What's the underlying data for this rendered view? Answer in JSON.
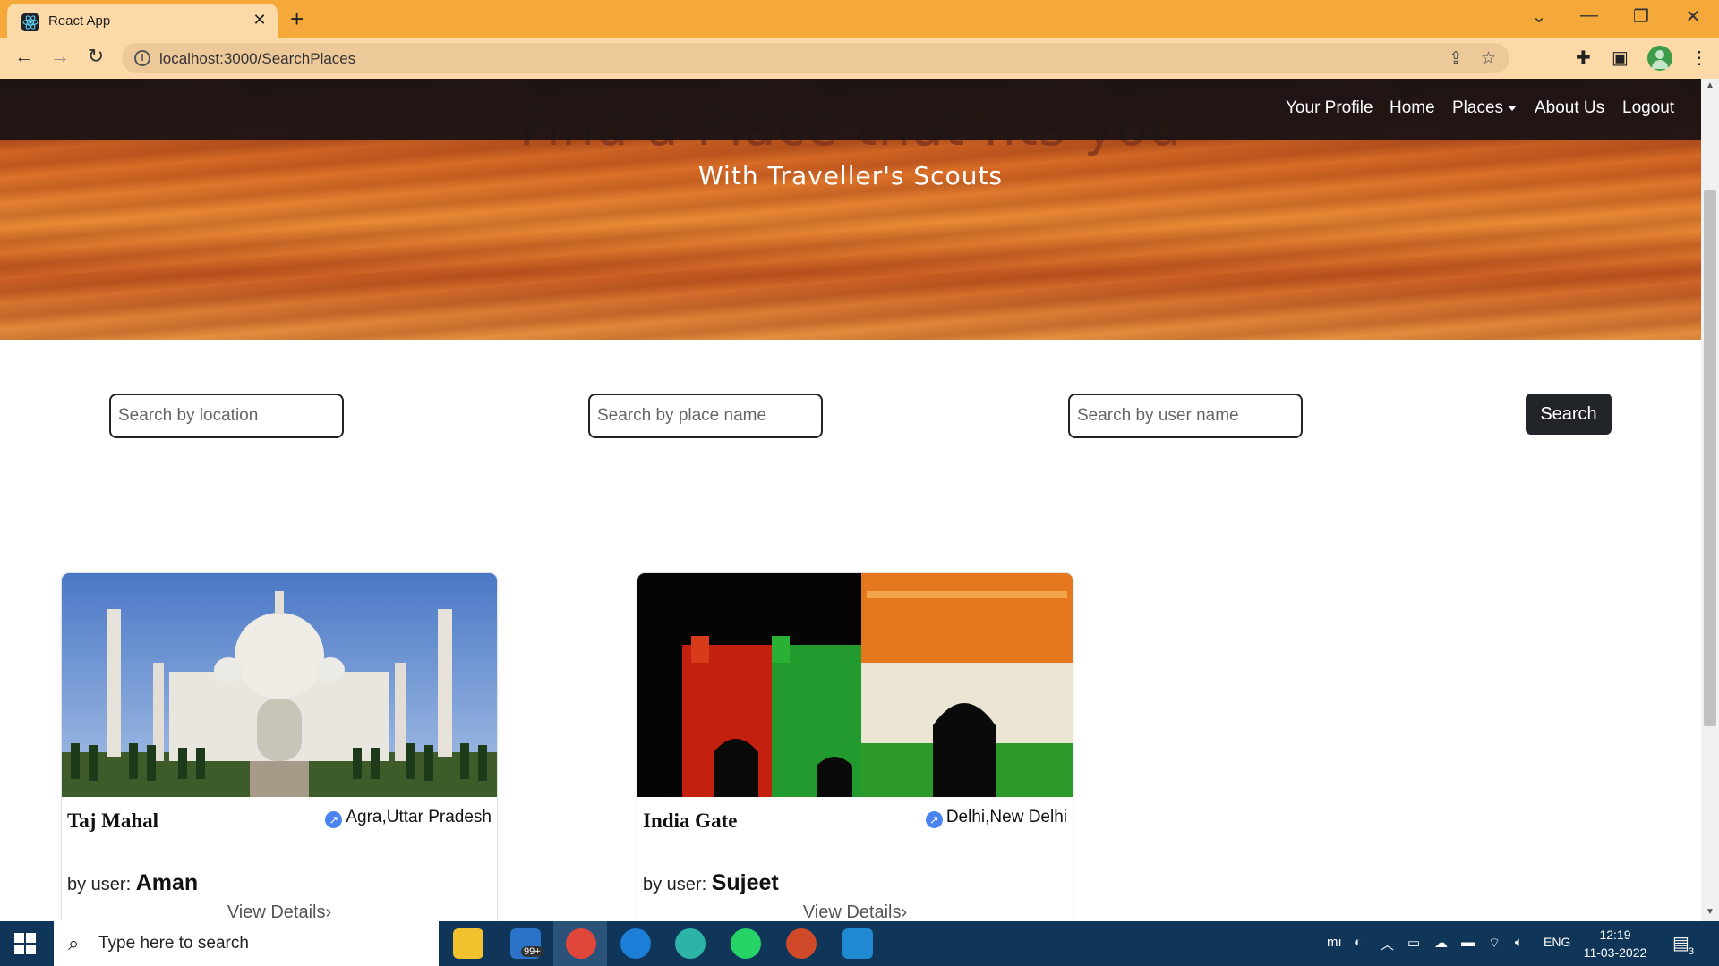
{
  "browser": {
    "tab_title": "React App",
    "tab_close": "✕",
    "new_tab": "+",
    "url": "localhost:3000/SearchPlaces"
  },
  "hero": {
    "heading": "Find a Place that fits you",
    "subheading": "With Traveller's Scouts"
  },
  "navbar": {
    "links": [
      {
        "label": "Your Profile"
      },
      {
        "label": "Home"
      },
      {
        "label": "Places"
      },
      {
        "label": "About Us"
      },
      {
        "label": "Logout"
      }
    ]
  },
  "search": {
    "location_placeholder": "Search by location",
    "place_placeholder": "Search by place name",
    "user_placeholder": "Search by user name",
    "button_label": "Search"
  },
  "cards": [
    {
      "name": "Taj Mahal",
      "location": "Agra,Uttar Pradesh",
      "by_label": "by user:",
      "user": "Aman",
      "details_label": "View Details"
    },
    {
      "name": "India Gate",
      "location": "Delhi,New Delhi",
      "by_label": "by user:",
      "user": "Sujeet",
      "details_label": "View Details"
    }
  ],
  "taskbar": {
    "search_text": "Type here to search",
    "language": "ENG",
    "time": "12:19",
    "date": "11-03-2022",
    "mail_badge": "99+",
    "notifications": "3"
  },
  "colors": {
    "navbar_bg": "#181214",
    "button_bg": "#212529",
    "chrome_tab": "#f6a93b",
    "taskbar": "#0f3559"
  }
}
